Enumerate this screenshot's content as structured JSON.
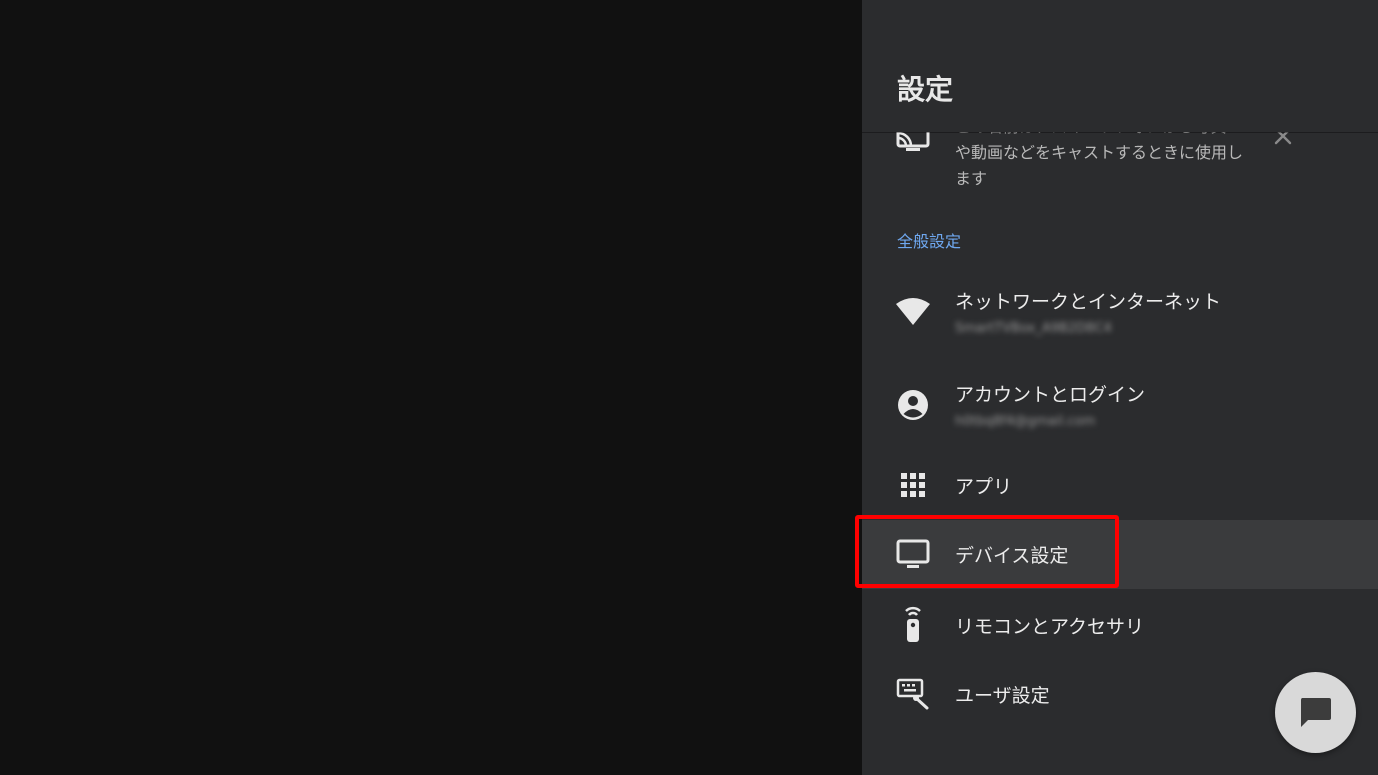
{
  "panel": {
    "title": "設定"
  },
  "cast_banner": {
    "text_line_hidden": "この名前は、スマートフォンから写真",
    "text": "や動画などをキャストするときに使用します",
    "icon": "cast-icon",
    "close_icon": "close-icon"
  },
  "section": {
    "label": "全般設定",
    "color": "#6fa8f0"
  },
  "items": [
    {
      "title": "ネットワークとインターネット",
      "subtitle": "SmartTVBox_A9B2D8C4",
      "icon": "wifi-icon"
    },
    {
      "title": "アカウントとログイン",
      "subtitle": "h0tbq8f4@gmail.com",
      "icon": "account-circle-icon"
    },
    {
      "title": "アプリ",
      "icon": "apps-grid-icon"
    },
    {
      "title": "デバイス設定",
      "icon": "tv-icon",
      "selected": true
    },
    {
      "title": "リモコンとアクセサリ",
      "icon": "remote-icon"
    },
    {
      "title": "ユーザ設定",
      "icon": "keyboard-user-icon"
    }
  ],
  "colors": {
    "panel_bg": "#2b2c2e",
    "selected_bg": "#3a3b3d",
    "highlight": "#ff0000"
  },
  "chat_button": {
    "icon": "chat-icon"
  }
}
